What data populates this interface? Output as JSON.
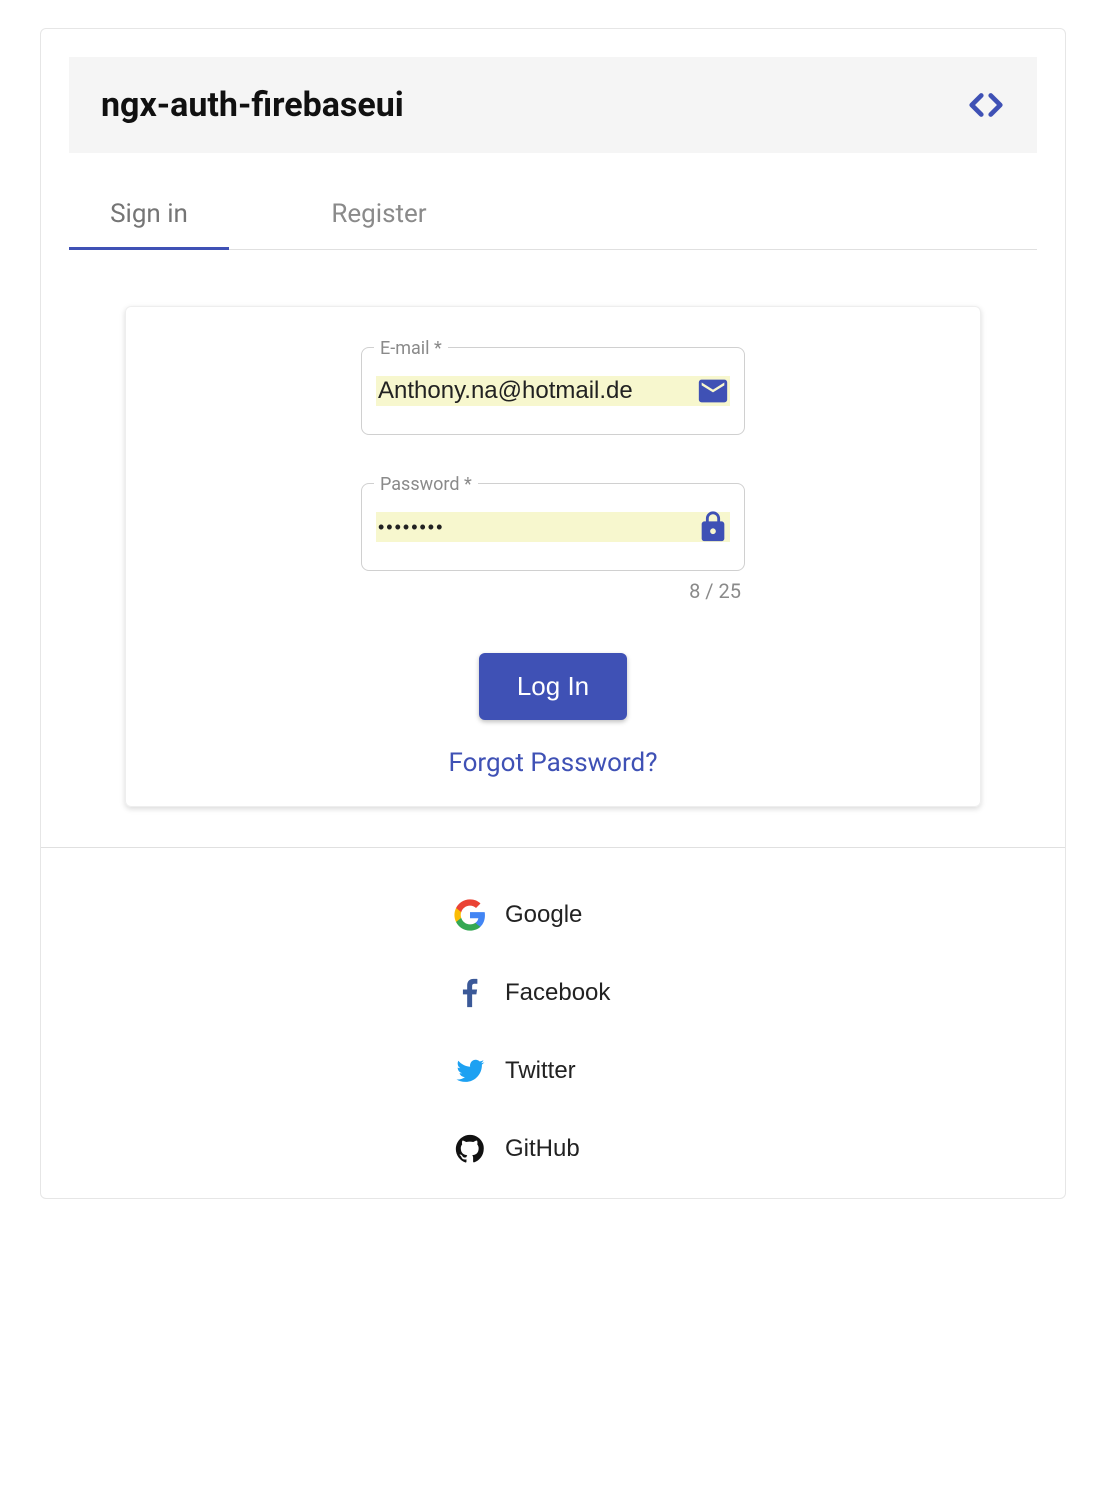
{
  "header": {
    "title": "ngx-auth-firebaseui"
  },
  "tabs": {
    "signin": "Sign in",
    "register": "Register"
  },
  "form": {
    "email_label": "E-mail *",
    "email_value": "Anthony.na@hotmail.de",
    "password_label": "Password *",
    "password_value": "••••••••",
    "password_count": "8 / 25",
    "login_button": "Log In",
    "forgot_link": "Forgot Password?"
  },
  "providers": {
    "google": "Google",
    "facebook": "Facebook",
    "twitter": "Twitter",
    "github": "GitHub"
  },
  "colors": {
    "primary": "#3f51b5",
    "autofill": "#f7f7ce"
  }
}
